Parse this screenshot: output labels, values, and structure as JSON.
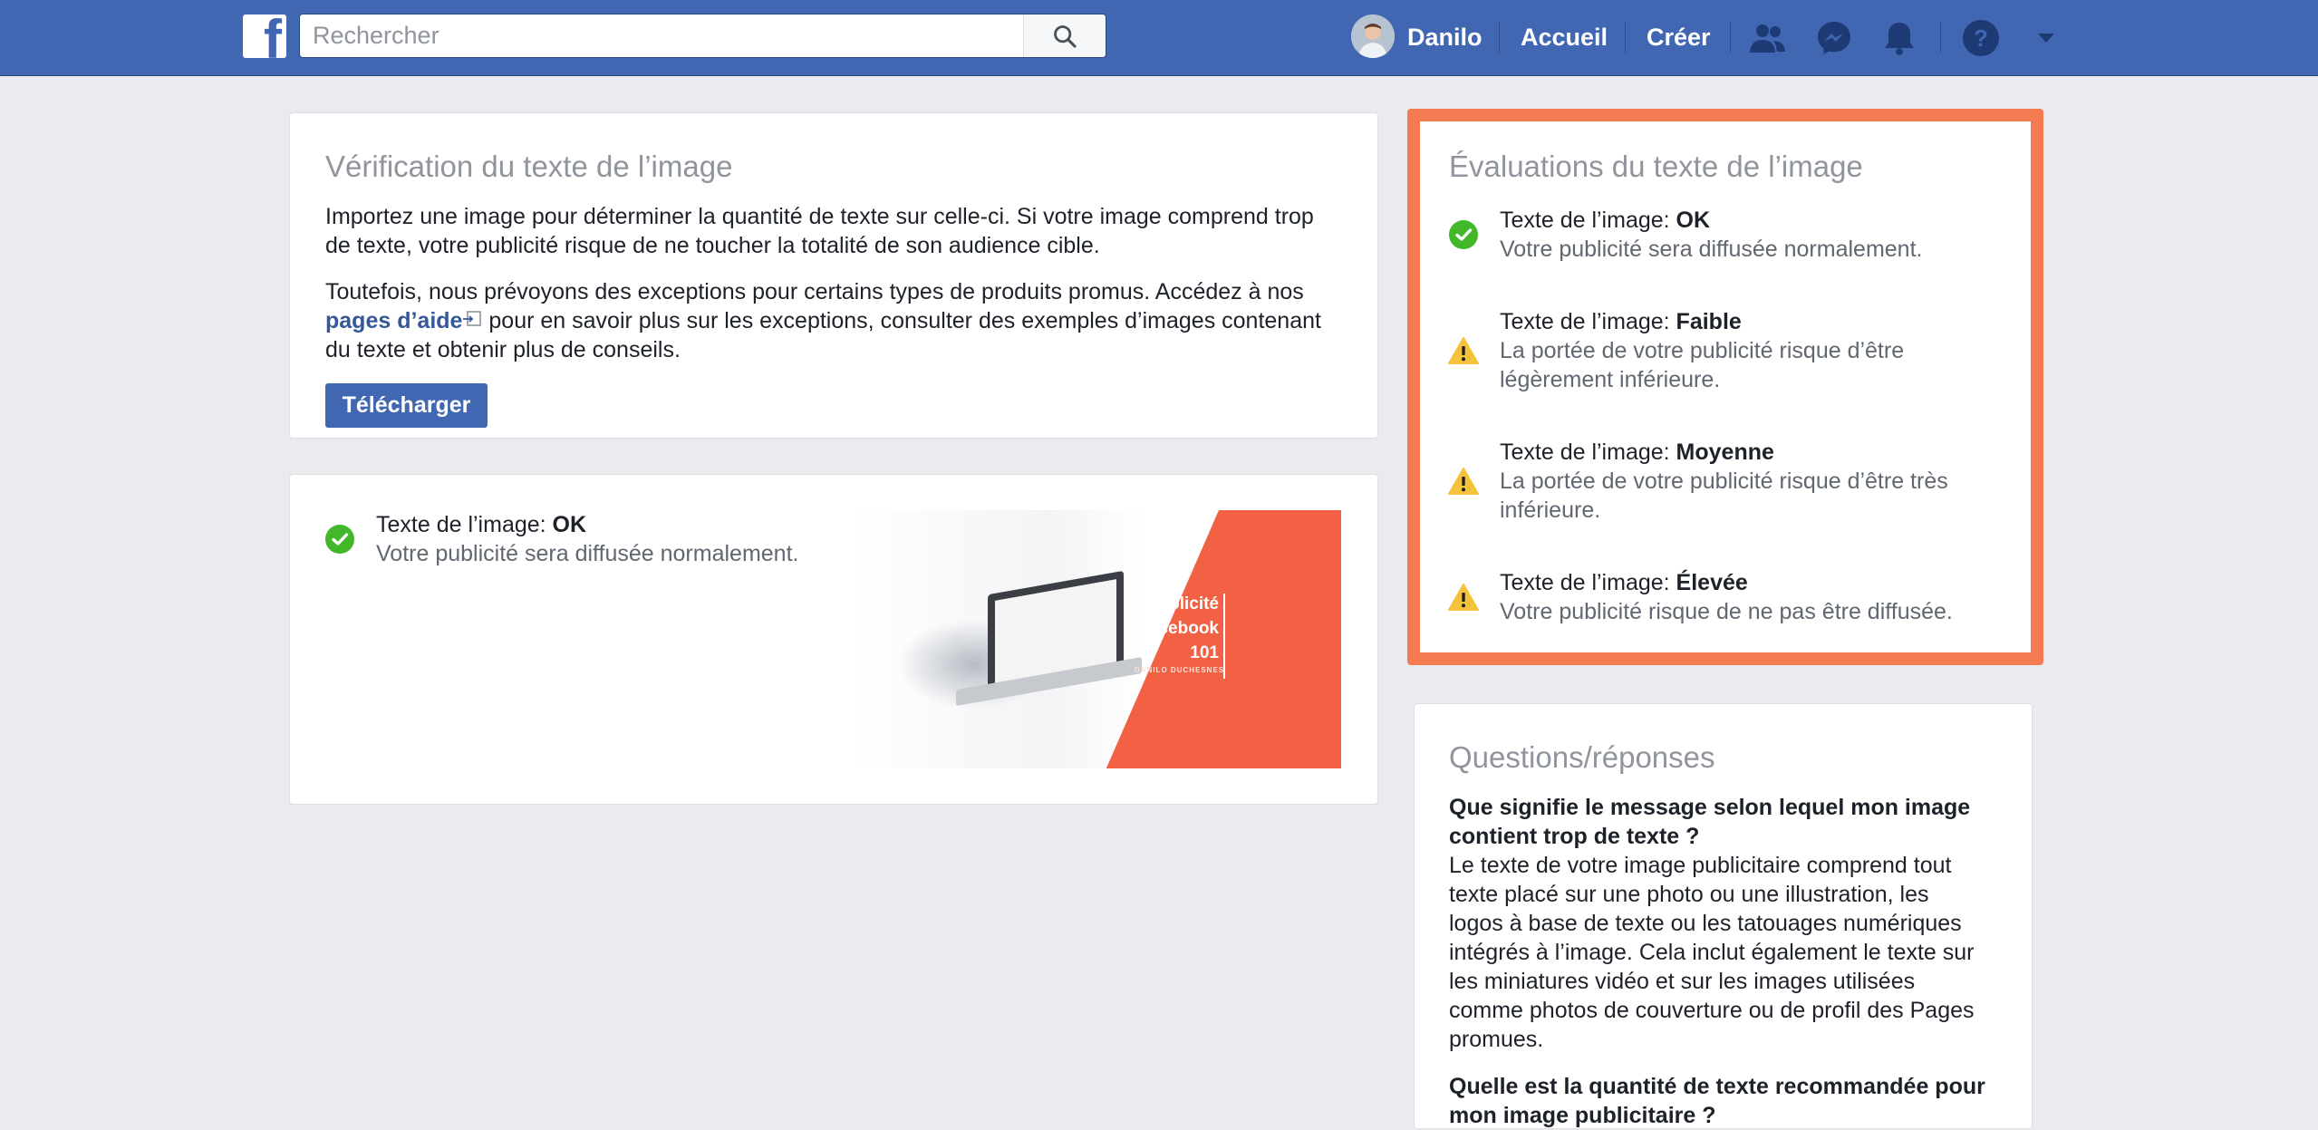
{
  "header": {
    "search_placeholder": "Rechercher",
    "user_name": "Danilo",
    "home_label": "Accueil",
    "create_label": "Créer"
  },
  "verification": {
    "title": "Vérification du texte de l’image",
    "intro": "Importez une image pour déterminer la quantité de texte sur celle-ci. Si votre image comprend trop de texte, votre publicité risque de ne toucher la totalité de son audience cible.",
    "exceptions_before": "Toutefois, nous prévoyons des exceptions pour certains types de produits promus. Accédez à nos ",
    "help_link": "pages d’aide",
    "exceptions_after": " pour en savoir plus sur les exceptions, consulter des exemples d’images contenant du texte et obtenir plus de conseils.",
    "upload_label": "Télécharger"
  },
  "result": {
    "label": "Texte de l’image: ",
    "value": "OK",
    "description": "Votre publicité sera diffusée normalement.",
    "preview_title_1": "Publicité",
    "preview_title_2": "Facebook",
    "preview_title_3": "101",
    "preview_author": "DANILO DUCHESNES"
  },
  "ratings": {
    "title": "Évaluations du texte de l’image",
    "items": [
      {
        "label": "Texte de l’image: ",
        "level": "OK",
        "description": "Votre publicité sera diffusée normalement.",
        "icon": "check-icon"
      },
      {
        "label": "Texte de l’image: ",
        "level": "Faible",
        "description_1": "La portée de votre publicité risque d’être",
        "description_2": "légèrement inférieure.",
        "icon": "warning-icon"
      },
      {
        "label": "Texte de l’image: ",
        "level": "Moyenne",
        "description_1": "La portée de votre publicité risque d’être très",
        "description_2": "inférieure.",
        "icon": "warning-icon"
      },
      {
        "label": "Texte de l’image: ",
        "level": "Élevée",
        "description": "Votre publicité risque de ne pas être diffusée.",
        "icon": "warning-icon"
      }
    ]
  },
  "qa": {
    "title": "Questions/réponses",
    "q1_line1": "Que signifie le message selon lequel mon image",
    "q1_line2": "contient trop de texte ?",
    "a1_lines": [
      "Le texte de votre image publicitaire comprend tout",
      "texte placé sur une photo ou une illustration, les",
      "logos à base de texte ou les tatouages numériques",
      "intégrés à l’image. Cela inclut également le texte sur",
      "les miniatures vidéo et sur les images utilisées",
      "comme photos de couverture ou de profil des Pages",
      "promues."
    ],
    "q2_line1": "Quelle est la quantité de texte recommandée pour",
    "q2_line2": "mon image publicitaire ?"
  },
  "colors": {
    "brand_blue": "#4267b2",
    "highlight_orange": "#f47b52",
    "ok_green": "#42b72a",
    "warning_yellow": "#f5c33b"
  }
}
